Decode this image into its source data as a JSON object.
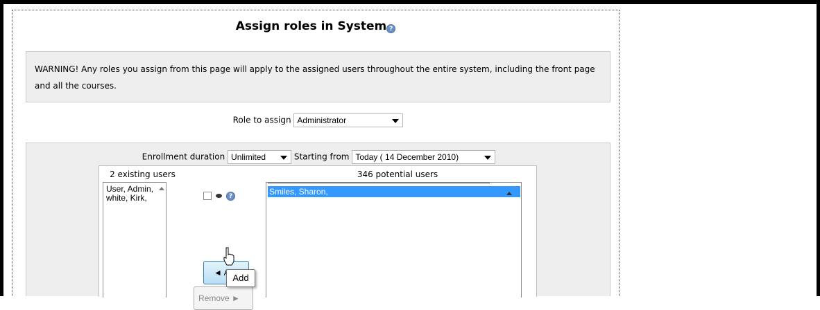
{
  "page": {
    "title": "Assign roles in System",
    "warning": "WARNING! Any roles you assign from this page will apply to the assigned users throughout the entire system, including the front page and all the courses."
  },
  "role": {
    "label": "Role to assign",
    "selected": "Administrator"
  },
  "enrollment": {
    "duration_label": "Enrollment duration",
    "duration_value": "Unlimited",
    "starting_label": "Starting from",
    "starting_value": "Today ( 14 December 2010)"
  },
  "existing": {
    "header": "2 existing users",
    "items": [
      "User, Admin,",
      "white, Kirk,"
    ]
  },
  "potential": {
    "header": "346 potential users",
    "items": [
      "Smiles, Sharon,"
    ]
  },
  "buttons": {
    "add": "◄ Add",
    "remove": "Remove ►"
  },
  "tooltip": "Add",
  "icons": {
    "help": "help-icon",
    "eye": "eye-icon",
    "cursor": "hand-pointer-icon"
  },
  "colors": {
    "selection": "#3399ff",
    "panel": "#eeeeee"
  }
}
